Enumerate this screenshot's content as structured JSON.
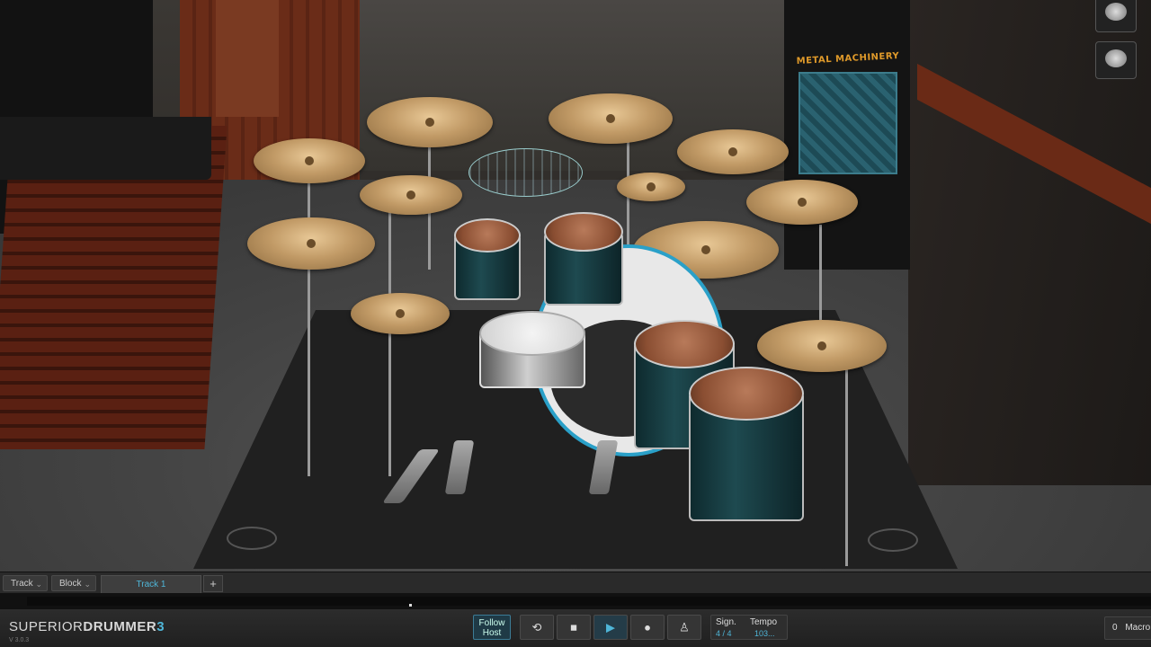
{
  "app": {
    "brand_part1": "SUPERIOR",
    "brand_part2": "DRUMMER",
    "brand_part3": "3",
    "version": "V 3.0.3"
  },
  "scene": {
    "banner_title": "METAL MACHINERY"
  },
  "track_bar": {
    "track_menu_label": "Track",
    "block_menu_label": "Block",
    "active_track_tab": "Track 1",
    "add_tab_label": "+"
  },
  "transport": {
    "follow_host_line1": "Follow",
    "follow_host_line2": "Host",
    "loop_icon": "loop-icon",
    "stop_icon": "stop-icon",
    "play_icon": "play-icon",
    "record_icon": "record-icon",
    "metronome_icon": "metronome-icon",
    "signature_label": "Sign.",
    "signature_value": "4 / 4",
    "tempo_label": "Tempo",
    "tempo_value": "103..."
  },
  "macro": {
    "count": "0",
    "label": "Macro"
  },
  "colors": {
    "accent": "#4fb6d8",
    "background": "#1b1b1b"
  }
}
